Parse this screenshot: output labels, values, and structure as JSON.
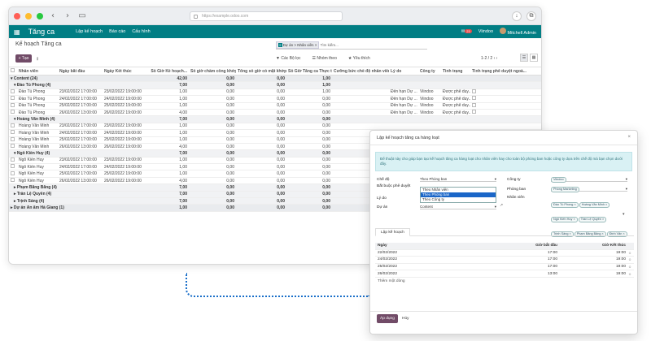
{
  "app": {
    "url": "https://example.odoo.com",
    "name": "Tăng ca",
    "menus": [
      "Lập kế hoạch",
      "Báo cáo",
      "Cấu hình"
    ],
    "notif_count": "23",
    "company": "Viindoo",
    "user": "Mitchell Admin"
  },
  "control": {
    "breadcrumb": "Kế hoạch Tăng ca",
    "new_label": "+ Tạo",
    "facet_label": "Dự án > Nhân viên",
    "search_placeholder": "Tìm kiếm...",
    "filters_label": "▼ Các Bộ lọc",
    "groupby_label": "☰ Nhóm theo",
    "favorites_label": "★ Yêu thích",
    "pager": "1-2 / 2"
  },
  "table": {
    "columns": [
      "Nhân viên",
      "Ngày bắt đầu",
      "Ngày Kết thúc",
      "Số Giờ Kế hoạch...",
      "Số giờ chấm công khớp",
      "Tổng số giờ có mặt khớp...",
      "Số Giờ Tăng ca Thực tế",
      "Cưỡng bức chế độ nhân viên...",
      "Lý do",
      "Công ty",
      "Tình trạng",
      "Tình trạng phê duyệt ngoà..."
    ],
    "rows": [
      {
        "type": "group",
        "label": "▾ Content (24)",
        "v1": "42,00",
        "v2": "0,00",
        "v3": "0,00",
        "v4": "1,00"
      },
      {
        "type": "sub",
        "label": "▾ Đào Tú Phong (4)",
        "v1": "7,00",
        "v2": "0,00",
        "v3": "0,00",
        "v4": "1,00"
      },
      {
        "type": "data",
        "emp": "Đào Tú Phong",
        "start": "23/02/2022 17:00:00",
        "end": "23/02/2022 19:00:00",
        "v1": "1,00",
        "v2": "0,00",
        "v3": "0,00",
        "v4": "1,00",
        "reason": "Đến hạn Dự ...",
        "company": "Viindoo",
        "state": "Được phê duy..."
      },
      {
        "type": "data",
        "emp": "Đào Tú Phong",
        "start": "24/02/2022 17:00:00",
        "end": "24/02/2022 19:00:00",
        "v1": "1,00",
        "v2": "0,00",
        "v3": "0,00",
        "v4": "0,00",
        "reason": "Đến hạn Dự ...",
        "company": "Viindoo",
        "state": "Được phê duy..."
      },
      {
        "type": "data",
        "emp": "Đào Tú Phong",
        "start": "25/02/2022 17:00:00",
        "end": "25/02/2022 19:00:00",
        "v1": "1,00",
        "v2": "0,00",
        "v3": "0,00",
        "v4": "0,00",
        "reason": "Đến hạn Dự ...",
        "company": "Viindoo",
        "state": "Được phê duy..."
      },
      {
        "type": "data",
        "emp": "Đào Tú Phong",
        "start": "26/02/2022 13:00:00",
        "end": "26/02/2022 19:00:00",
        "v1": "4,00",
        "v2": "0,00",
        "v3": "0,00",
        "v4": "0,00",
        "reason": "Đến hạn Dự ...",
        "company": "Viindoo",
        "state": "Được phê duy..."
      },
      {
        "type": "sub",
        "label": "▾ Hoàng Văn Minh (4)",
        "v1": "7,00",
        "v2": "0,00",
        "v3": "0,00",
        "v4": "0,00"
      },
      {
        "type": "data",
        "emp": "Hoàng Văn Minh",
        "start": "23/02/2022 17:00:00",
        "end": "23/02/2022 19:00:00",
        "v1": "1,00",
        "v2": "0,00",
        "v3": "0,00",
        "v4": "0,00",
        "reason": "",
        "company": "",
        "state": ""
      },
      {
        "type": "data",
        "emp": "Hoàng Văn Minh",
        "start": "24/02/2022 17:00:00",
        "end": "24/02/2022 19:00:00",
        "v1": "1,00",
        "v2": "0,00",
        "v3": "0,00",
        "v4": "0,00",
        "reason": "",
        "company": "",
        "state": ""
      },
      {
        "type": "data",
        "emp": "Hoàng Văn Minh",
        "start": "25/02/2022 17:00:00",
        "end": "25/02/2022 19:00:00",
        "v1": "1,00",
        "v2": "0,00",
        "v3": "0,00",
        "v4": "0,00",
        "reason": "",
        "company": "",
        "state": ""
      },
      {
        "type": "data",
        "emp": "Hoàng Văn Minh",
        "start": "26/02/2022 13:00:00",
        "end": "26/02/2022 19:00:00",
        "v1": "4,00",
        "v2": "0,00",
        "v3": "0,00",
        "v4": "0,00",
        "reason": "",
        "company": "",
        "state": ""
      },
      {
        "type": "sub",
        "label": "▾ Ngô Kiến Huy (4)",
        "v1": "7,00",
        "v2": "0,00",
        "v3": "0,00",
        "v4": "0,00"
      },
      {
        "type": "data",
        "emp": "Ngô Kiến Huy",
        "start": "23/02/2022 17:00:00",
        "end": "23/02/2022 19:00:00",
        "v1": "1,00",
        "v2": "0,00",
        "v3": "0,00",
        "v4": "0,00",
        "reason": "",
        "company": "",
        "state": ""
      },
      {
        "type": "data",
        "emp": "Ngô Kiến Huy",
        "start": "24/02/2022 17:00:00",
        "end": "24/02/2022 19:00:00",
        "v1": "1,00",
        "v2": "0,00",
        "v3": "0,00",
        "v4": "0,00",
        "reason": "",
        "company": "",
        "state": ""
      },
      {
        "type": "data",
        "emp": "Ngô Kiến Huy",
        "start": "25/02/2022 17:00:00",
        "end": "25/02/2022 19:00:00",
        "v1": "1,00",
        "v2": "0,00",
        "v3": "0,00",
        "v4": "0,00",
        "reason": "",
        "company": "",
        "state": ""
      },
      {
        "type": "data",
        "emp": "Ngô Kiến Huy",
        "start": "26/02/2022 13:00:00",
        "end": "26/02/2022 19:00:00",
        "v1": "4,00",
        "v2": "0,00",
        "v3": "0,00",
        "v4": "0,00",
        "reason": "",
        "company": "",
        "state": ""
      },
      {
        "type": "sub",
        "label": "▸ Phạm Băng Băng (4)",
        "v1": "7,00",
        "v2": "0,00",
        "v3": "0,00",
        "v4": "0,00"
      },
      {
        "type": "sub",
        "label": "▸ Trần Lệ Quyên (4)",
        "v1": "7,00",
        "v2": "0,00",
        "v3": "0,00",
        "v4": "0,00"
      },
      {
        "type": "sub",
        "label": "▸ Trịnh Sảng (4)",
        "v1": "7,00",
        "v2": "0,00",
        "v3": "0,00",
        "v4": "0,00"
      },
      {
        "type": "group",
        "label": "▸ Dự án Ẩn ẩm Hà Giang (1)",
        "v1": "1,00",
        "v2": "0,00",
        "v3": "0,00",
        "v4": "0,00"
      }
    ]
  },
  "modal": {
    "title": "Lập kế hoạch tăng ca hàng loạt",
    "close": "×",
    "note": "Để thuật này cho giúp bạn tạo kế hoạch tăng ca hàng loạt cho nhân viên hay cho toàn bộ phòng ban hoặc công ty dựa trên chế độ mà bạn chọn dưới đây.",
    "mode_label": "Chế độ",
    "mode_value": "Theo Phòng ban",
    "mode_options": [
      "Theo Nhân viên",
      "Theo Phòng ban",
      "Theo Công ty"
    ],
    "approval_label": "Bắt buộc phê duyệt",
    "reason_label": "Lý do",
    "reason_value": "Đến hạn Dự án",
    "project_label": "Dự án",
    "project_value": "Content",
    "company_label": "Công ty",
    "company_value": "Viindoo",
    "dept_label": "Phòng ban",
    "dept_value": "Phòng Marketing",
    "employee_label": "Nhân viên",
    "employee_tags": [
      "Đào Tú Phong ×",
      "Hoàng Văn Minh ×",
      "Ngô Kiến Huy ×",
      "Trần Lệ Quyên ×",
      "Trịnh Sảng ×",
      "Phạm Băng Băng ×",
      "Đinh Văn ×"
    ],
    "tab_label": "Lập kế hoạch",
    "plan_headers": [
      "Ngày",
      "Giờ bắt đầu",
      "Giờ Kết thúc"
    ],
    "plan_rows": [
      [
        "22/02/2022",
        "17:00",
        "19:00"
      ],
      [
        "24/02/2022",
        "17:00",
        "19:00"
      ],
      [
        "25/02/2022",
        "17:00",
        "19:00"
      ],
      [
        "26/02/2022",
        "13:00",
        "19:00"
      ]
    ],
    "add_line": "Thêm một dòng",
    "ok_label": "Áp dụng",
    "cancel_label": "Hủy"
  }
}
